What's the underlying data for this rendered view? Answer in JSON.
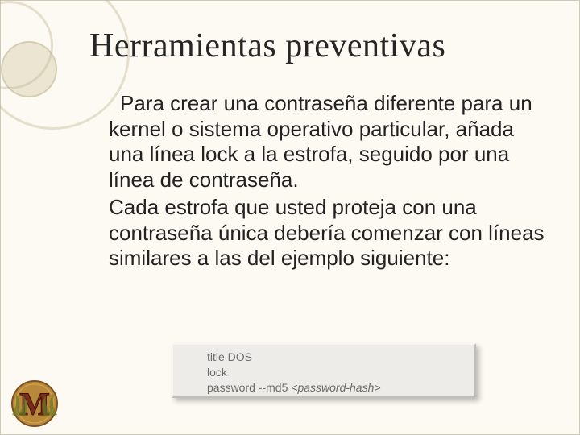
{
  "title": "Herramientas preventivas",
  "body": {
    "p1": "Para crear una contraseña diferente para un kernel o sistema operativo particular, añada una línea lock a la estrofa, seguido por una línea de contraseña.",
    "p2": "Cada estrofa que usted proteja con una contraseña única debería comenzar con líneas similares a las del ejemplo siguiente:"
  },
  "code": {
    "line1": "title DOS",
    "line2": "lock",
    "line3_prefix": "password --md5 ",
    "line3_italic": "<password-hash>"
  },
  "emblem_letter": "M"
}
